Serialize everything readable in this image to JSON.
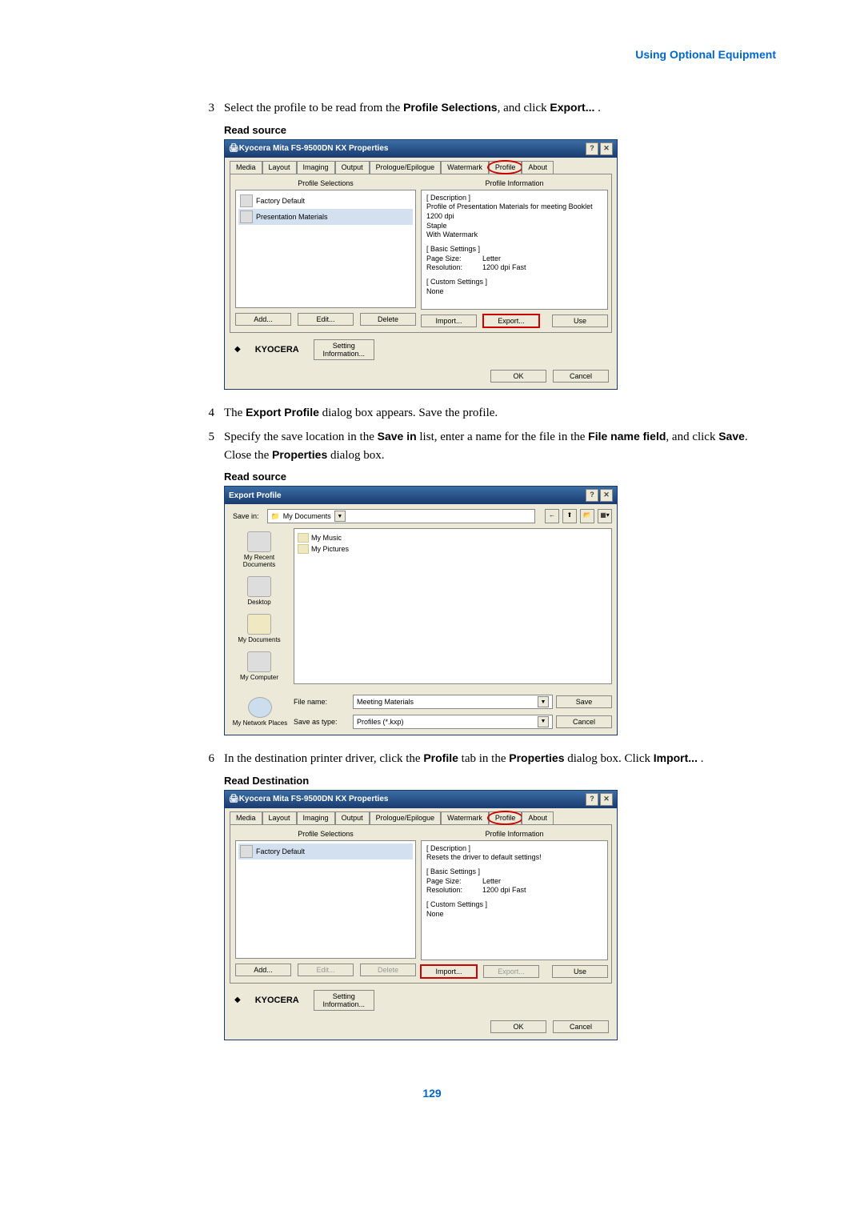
{
  "header": "Using Optional Equipment",
  "steps": {
    "s3": {
      "num": "3",
      "pre": "Select the profile to be read from the ",
      "b1": "Profile Selections",
      "mid": ", and click ",
      "b2": "Export...",
      "post": " ."
    },
    "s4": {
      "num": "4",
      "pre": "The ",
      "b1": "Export Profile",
      "post": " dialog box appears. Save the profile."
    },
    "s5": {
      "num": "5",
      "pre": "Specify the save location in the ",
      "b1": "Save in",
      "mid1": " list, enter a name for the file in the ",
      "b2": "File name field",
      "mid2": ", and click ",
      "b3": "Save",
      "mid3": ". Close the ",
      "b4": "Properties",
      "post": " dialog box."
    },
    "s6": {
      "num": "6",
      "pre": "In the destination printer driver, click the ",
      "b1": "Profile",
      "mid1": " tab in the ",
      "b2": "Properties",
      "mid2": " dialog box. Click ",
      "b3": "Import...",
      "post": " ."
    }
  },
  "subtitle_source": "Read source",
  "subtitle_dest": "Read Destination",
  "dlg": {
    "title": "Kyocera Mita FS-9500DN KX Properties",
    "tabs": [
      "Media",
      "Layout",
      "Imaging",
      "Output",
      "Prologue/Epilogue",
      "Watermark",
      "Profile",
      "About"
    ],
    "col_selections": "Profile Selections",
    "col_info": "Profile Information",
    "factory": "Factory Default",
    "presentation": "Presentation Materials",
    "info1": {
      "desc_h": "[ Description ]",
      "desc": "Profile of Presentation Materials for meeting Booklet",
      "desc2": "1200 dpi",
      "desc3": "Staple",
      "desc4": "With Watermark",
      "basic_h": "[ Basic Settings ]",
      "page_l": "Page Size:",
      "page_v": "Letter",
      "res_l": "Resolution:",
      "res_v": "1200 dpi Fast",
      "cust_h": "[ Custom Settings ]",
      "cust_v": "None"
    },
    "info2": {
      "desc_h": "[ Description ]",
      "desc": "Resets the driver to default settings!",
      "basic_h": "[ Basic Settings ]",
      "page_l": "Page Size:",
      "page_v": "Letter",
      "res_l": "Resolution:",
      "res_v": "1200 dpi Fast",
      "cust_h": "[ Custom Settings ]",
      "cust_v": "None"
    },
    "btn_add": "Add...",
    "btn_edit": "Edit...",
    "btn_delete": "Delete",
    "btn_import": "Import...",
    "btn_export": "Export...",
    "btn_use": "Use",
    "btn_setting": "Setting Information...",
    "brand": "KYOCERA",
    "btn_ok": "OK",
    "btn_cancel": "Cancel"
  },
  "exp": {
    "title": "Export Profile",
    "save_in": "Save in:",
    "save_folder": "My Documents",
    "folders": [
      "My Music",
      "My Pictures"
    ],
    "places": [
      "My Recent Documents",
      "Desktop",
      "My Documents",
      "My Computer",
      "My Network Places"
    ],
    "file_name_l": "File name:",
    "file_name_v": "Meeting Materials",
    "save_type_l": "Save as type:",
    "save_type_v": "Profiles (*.kxp)",
    "btn_save": "Save",
    "btn_cancel": "Cancel"
  },
  "page_number": "129"
}
